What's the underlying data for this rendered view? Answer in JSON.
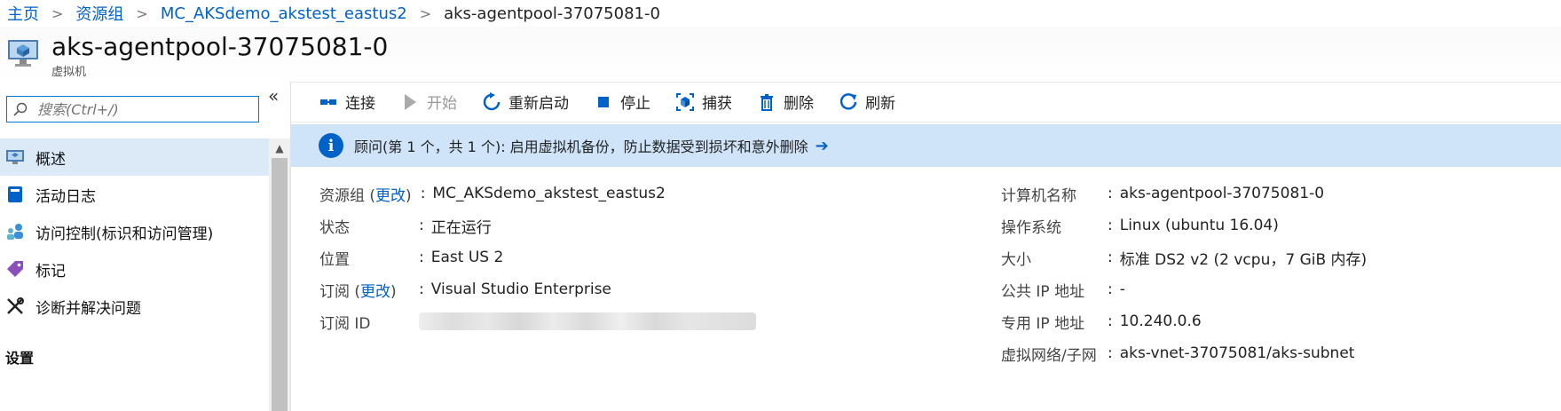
{
  "breadcrumb": {
    "items": [
      "主页",
      "资源组",
      "MC_AKSdemo_akstest_eastus2"
    ],
    "current": "aks-agentpool-37075081-0"
  },
  "header": {
    "title": "aks-agentpool-37075081-0",
    "subtitle": "虚拟机"
  },
  "sidebar": {
    "search_placeholder": "搜索(Ctrl+/)",
    "collapse_glyph": "«",
    "items": [
      {
        "label": "概述",
        "icon": "monitor-icon",
        "active": true
      },
      {
        "label": "活动日志",
        "icon": "log-icon",
        "active": false
      },
      {
        "label": "访问控制(标识和访问管理)",
        "icon": "people-icon",
        "active": false
      },
      {
        "label": "标记",
        "icon": "tag-icon",
        "active": false
      },
      {
        "label": "诊断并解决问题",
        "icon": "wrench-icon",
        "active": false
      }
    ],
    "section_label": "设置"
  },
  "toolbar": {
    "connect": "连接",
    "start": "开始",
    "restart": "重新启动",
    "stop": "停止",
    "capture": "捕获",
    "delete": "删除",
    "refresh": "刷新"
  },
  "banner": {
    "text": "顾问(第 1 个，共 1 个): 启用虚拟机备份，防止数据受到损坏和意外删除",
    "arrow": "➔"
  },
  "properties_left": {
    "resource_group_label": "资源组",
    "resource_group_change": "更改",
    "resource_group_value": "MC_AKSdemo_akstest_eastus2",
    "status_label": "状态",
    "status_value": "正在运行",
    "location_label": "位置",
    "location_value": "East US 2",
    "subscription_label": "订阅",
    "subscription_change": "更改",
    "subscription_value": "Visual Studio Enterprise",
    "subscription_id_label": "订阅 ID"
  },
  "properties_right": {
    "computer_name_label": "计算机名称",
    "computer_name_value": "aks-agentpool-37075081-0",
    "os_label": "操作系统",
    "os_value": "Linux (ubuntu 16.04)",
    "size_label": "大小",
    "size_value": "标准 DS2 v2 (2 vcpu，7 GiB 内存)",
    "public_ip_label": "公共 IP 地址",
    "public_ip_value": "-",
    "private_ip_label": "专用 IP 地址",
    "private_ip_value": "10.240.0.6",
    "vnet_label": "虚拟网络/子网",
    "vnet_value": "aks-vnet-37075081/aks-subnet"
  },
  "colors": {
    "link": "#0062c8",
    "banner_bg": "#cfe4f8",
    "active_nav": "#dceaf8"
  }
}
